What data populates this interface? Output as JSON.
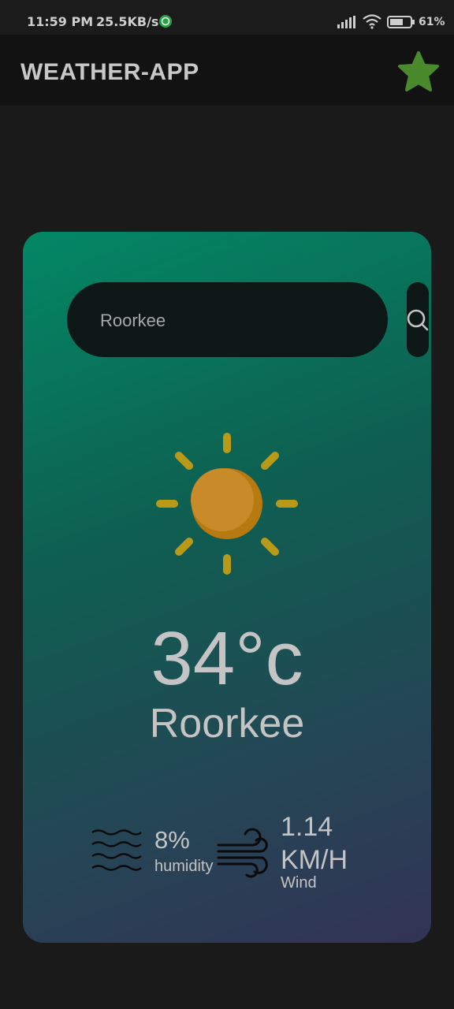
{
  "status_bar": {
    "time": "11:59 PM",
    "net_speed": "25.5KB/s",
    "battery_text": "61%",
    "icons": [
      "whatsapp-icon",
      "signal-icon",
      "wifi-icon",
      "battery-icon"
    ]
  },
  "app_bar": {
    "title": "WEATHER-APP",
    "favorite_icon": "star-icon",
    "star_color": "#4a8a2c"
  },
  "search": {
    "value": "Roorkee",
    "button_icon": "search-icon"
  },
  "weather": {
    "icon": "sun-icon",
    "temperature": "34°c",
    "city": "Roorkee",
    "humidity_value": "8%",
    "humidity_label": "humidity",
    "wind_value": "1.14 KM/H",
    "wind_label": "Wind"
  },
  "colors": {
    "background": "#1a1a1a",
    "app_bar": "#121212",
    "card_gradient": [
      "#04a67c",
      "#3f3f68"
    ],
    "search_pill": "#0d1716",
    "sun": "#c98a1e",
    "sun_rays": "#b89a18",
    "text": "#c4c4c4"
  }
}
